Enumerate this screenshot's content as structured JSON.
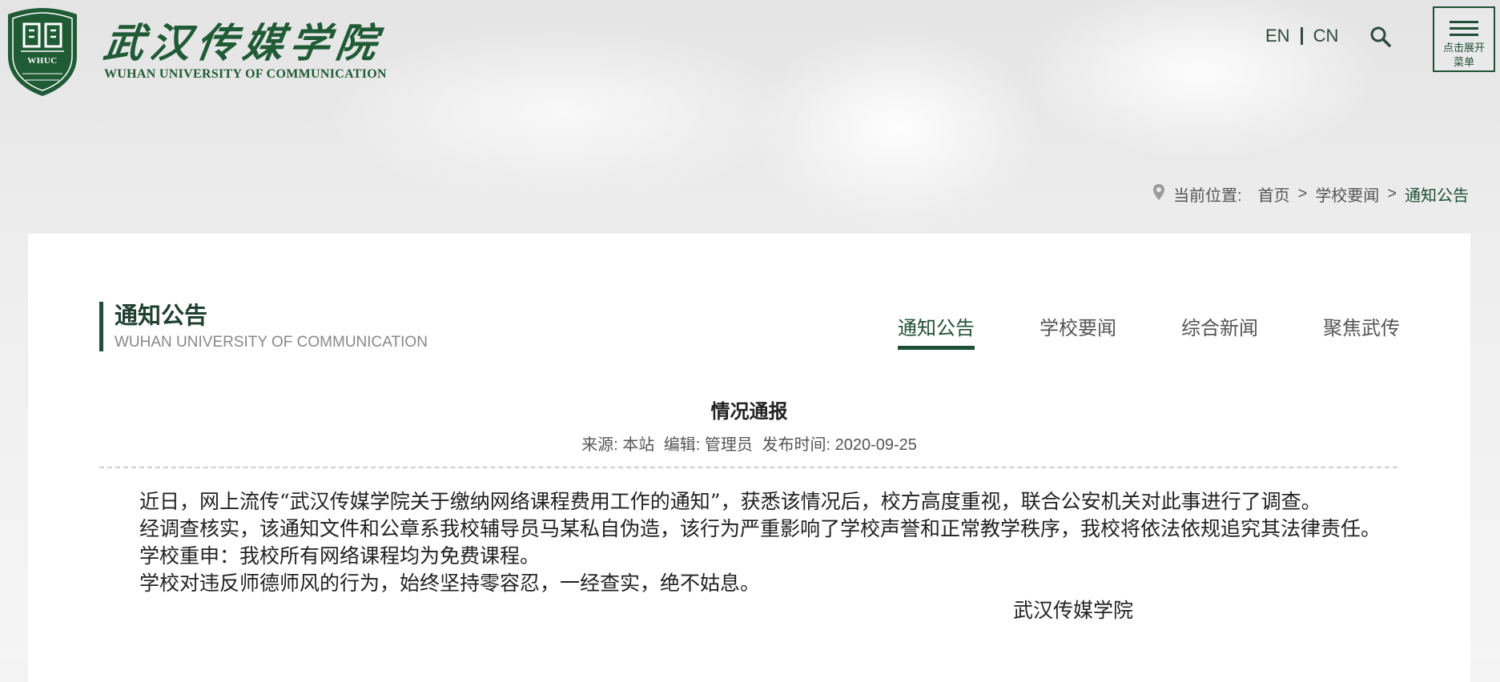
{
  "colors": {
    "brand": "#1f5b35",
    "accent": "#1f4f36",
    "panel_bg": "#ffffff"
  },
  "header": {
    "logo_cn": "武汉传媒学院",
    "logo_en": "WUHAN UNIVERSITY OF COMMUNICATION",
    "crest_text": "WHUC",
    "lang_en": "EN",
    "lang_cn": "CN",
    "search_icon": "search-icon",
    "menu_icon": "hamburger-icon",
    "menu_label": "点击展开菜单"
  },
  "breadcrumb": {
    "label": "当前位置:",
    "items": [
      "首页",
      "学校要闻"
    ],
    "current": "通知公告",
    "separator": ">"
  },
  "section": {
    "title": "通知公告",
    "subtitle": "WUHAN UNIVERSITY OF COMMUNICATION"
  },
  "tabs": [
    {
      "label": "通知公告",
      "active": true
    },
    {
      "label": "学校要闻",
      "active": false
    },
    {
      "label": "综合新闻",
      "active": false
    },
    {
      "label": "聚焦武传",
      "active": false
    }
  ],
  "article": {
    "title": "情况通报",
    "source": "来源: 本站",
    "editor": "编辑: 管理员",
    "date": "发布时间: 2020-09-25",
    "paragraphs": [
      "近日，网上流传“武汉传媒学院关于缴纳网络课程费用工作的通知”，获悉该情况后，校方高度重视，联合公安机关对此事进行了调查。",
      "经调查核实，该通知文件和公章系我校辅导员马某私自伪造，该行为严重影响了学校声誉和正常教学秩序，我校将依法依规追究其法律责任。",
      "学校重申：我校所有网络课程均为免费课程。",
      "学校对违反师德师风的行为，始终坚持零容忍，一经查实，绝不姑息。"
    ],
    "signature": "武汉传媒学院"
  }
}
